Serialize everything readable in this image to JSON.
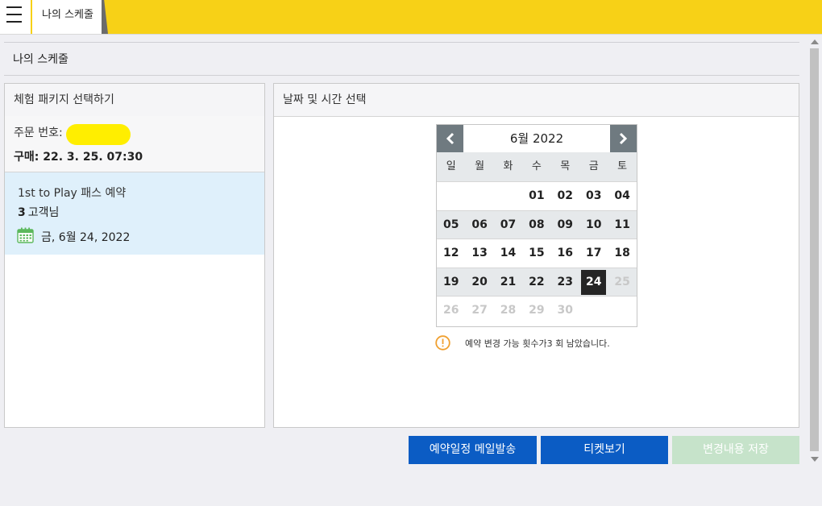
{
  "tab": {
    "label": "나의 스케줄"
  },
  "page": {
    "title": "나의 스케줄"
  },
  "left_panel": {
    "title": "체험 패키지 선택하기",
    "order_label": "주문 번호:",
    "purchase": "구매: 22. 3. 25. 07:30",
    "booking": {
      "title": "1st to Play 패스 예약",
      "guest_count": "3",
      "guest_label": "고객님",
      "date": "금, 6월 24, 2022"
    }
  },
  "right_panel": {
    "title": "날짜 및 시간 선택",
    "calendar": {
      "month_year": "6월 2022",
      "weekdays": [
        "일",
        "월",
        "화",
        "수",
        "목",
        "금",
        "토"
      ],
      "weeks": [
        [
          "",
          "",
          "",
          "01",
          "02",
          "03",
          "04"
        ],
        [
          "05",
          "06",
          "07",
          "08",
          "09",
          "10",
          "11"
        ],
        [
          "12",
          "13",
          "14",
          "15",
          "16",
          "17",
          "18"
        ],
        [
          "19",
          "20",
          "21",
          "22",
          "23",
          "24",
          "25"
        ],
        [
          "26",
          "27",
          "28",
          "29",
          "30",
          "",
          ""
        ]
      ],
      "selected_day": "24",
      "disabled_days": [
        "25",
        "26",
        "27",
        "28",
        "29",
        "30"
      ]
    },
    "notice": "예약 변경 가능 횟수가3 회 남았습니다."
  },
  "buttons": {
    "mail": "예약일정 메일발송",
    "ticket": "티켓보기",
    "save": "변경내용 저장"
  },
  "colors": {
    "topbar": "#f7d117",
    "primary_button": "#0b5cc4",
    "disabled_button": "#c6e3ca",
    "booking_bg": "#dff0fb",
    "selected_day": "#252525"
  }
}
